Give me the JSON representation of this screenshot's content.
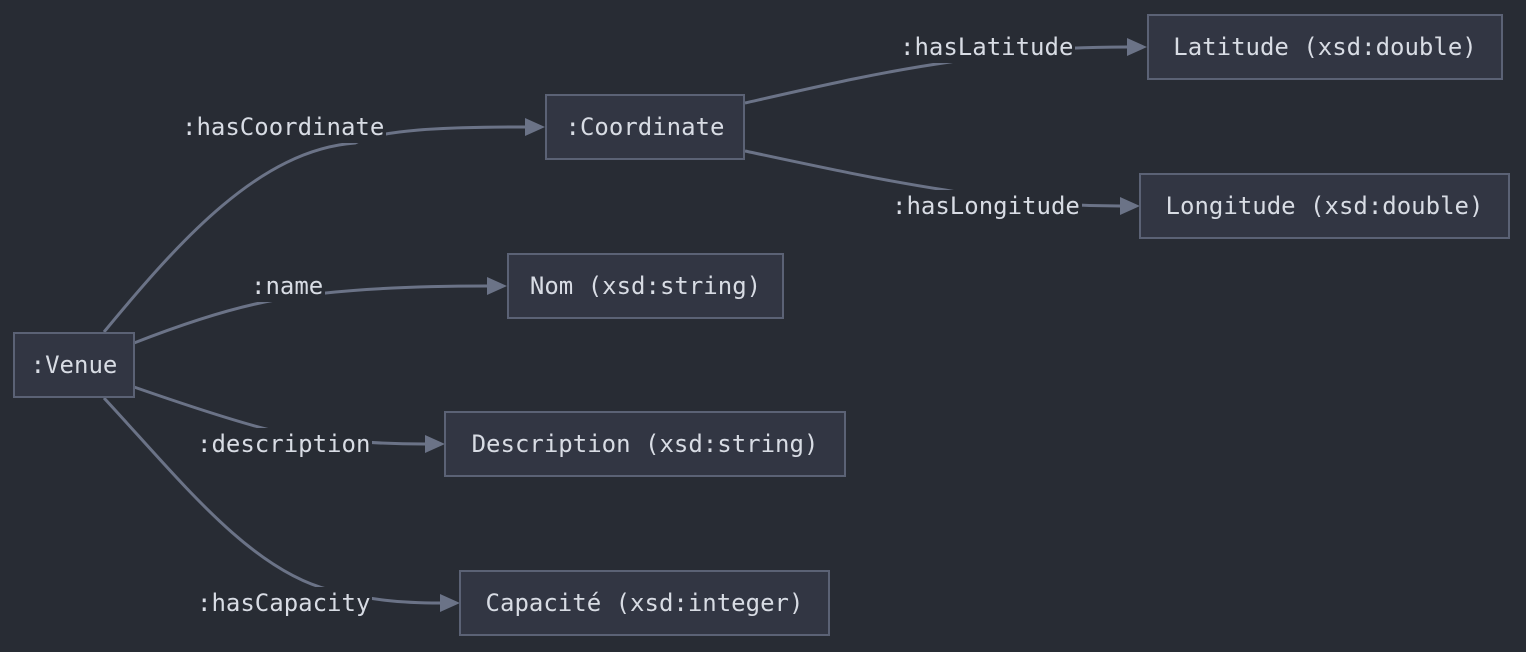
{
  "diagram": {
    "colors": {
      "background": "#282c34",
      "node_fill": "#323643",
      "node_border": "#5b6275",
      "edge": "#6b7387",
      "text": "#d8dce4"
    },
    "nodes": {
      "venue": ":Venue",
      "coordinate": ":Coordinate",
      "nom": "Nom (xsd:string)",
      "description": "Description (xsd:string)",
      "capacite": "Capacité (xsd:integer)",
      "latitude": "Latitude (xsd:double)",
      "longitude": "Longitude (xsd:double)"
    },
    "edges": {
      "has_coordinate": ":hasCoordinate",
      "name": ":name",
      "description": ":description",
      "has_capacity": ":hasCapacity",
      "has_latitude": ":hasLatitude",
      "has_longitude": ":hasLongitude"
    }
  }
}
